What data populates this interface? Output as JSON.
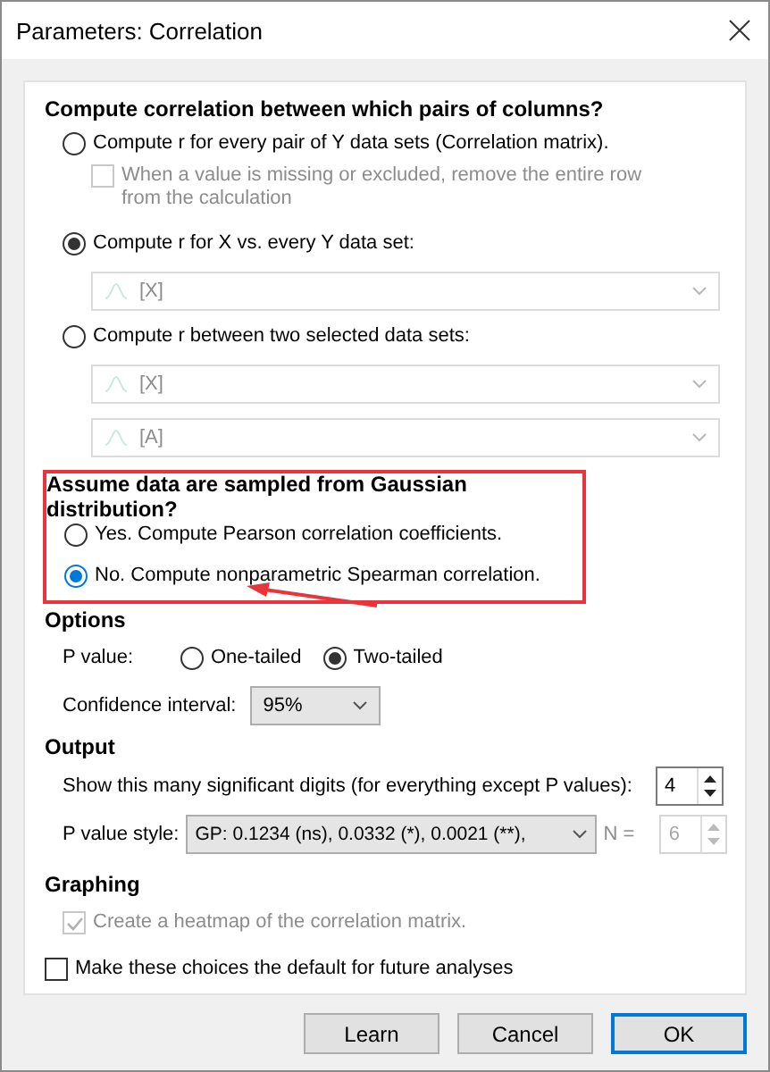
{
  "window": {
    "title": "Parameters: Correlation"
  },
  "pairs": {
    "heading": "Compute correlation between which pairs of columns?",
    "options": [
      {
        "label": "Compute r for every pair of Y data sets (Correlation matrix).",
        "selected": false,
        "checkbox": {
          "label": "When a value is missing or excluded, remove the entire row from the calculation",
          "checked": false,
          "disabled": true
        }
      },
      {
        "label": "Compute r for X vs. every Y data set:",
        "selected": true,
        "dropdowns": [
          {
            "value": "[X]",
            "disabled": true
          }
        ]
      },
      {
        "label": "Compute r between two selected data sets:",
        "selected": false,
        "dropdowns": [
          {
            "value": "[X]",
            "disabled": true
          },
          {
            "value": "[A]",
            "disabled": true
          }
        ]
      }
    ]
  },
  "gaussian": {
    "heading": "Assume data are sampled from Gaussian distribution?",
    "options": [
      {
        "label": "Yes. Compute Pearson correlation coefficients.",
        "selected": false,
        "focused": false
      },
      {
        "label": "No. Compute nonparametric Spearman correlation.",
        "selected": true,
        "focused": true
      }
    ]
  },
  "options": {
    "heading": "Options",
    "p_value": {
      "label": "P value:",
      "choices": [
        {
          "label": "One-tailed",
          "selected": false
        },
        {
          "label": "Two-tailed",
          "selected": true
        }
      ]
    },
    "confidence": {
      "label": "Confidence interval:",
      "value": "95%"
    }
  },
  "output": {
    "heading": "Output",
    "digits": {
      "label": "Show this many significant digits (for everything except P values):",
      "value": "4"
    },
    "p_style": {
      "label": "P value style:",
      "value": "GP: 0.1234 (ns), 0.0332 (*), 0.0021 (**),",
      "n_label": "N =",
      "n_value": "6",
      "n_disabled": true
    }
  },
  "graphing": {
    "heading": "Graphing",
    "heatmap": {
      "label": "Create a heatmap of the correlation matrix.",
      "checked": true,
      "disabled": true
    }
  },
  "default_choice": {
    "label": "Make these choices the default for future analyses",
    "checked": false
  },
  "buttons": [
    {
      "label": "Learn",
      "default": false
    },
    {
      "label": "Cancel",
      "default": false
    },
    {
      "label": "OK",
      "default": true
    }
  ]
}
